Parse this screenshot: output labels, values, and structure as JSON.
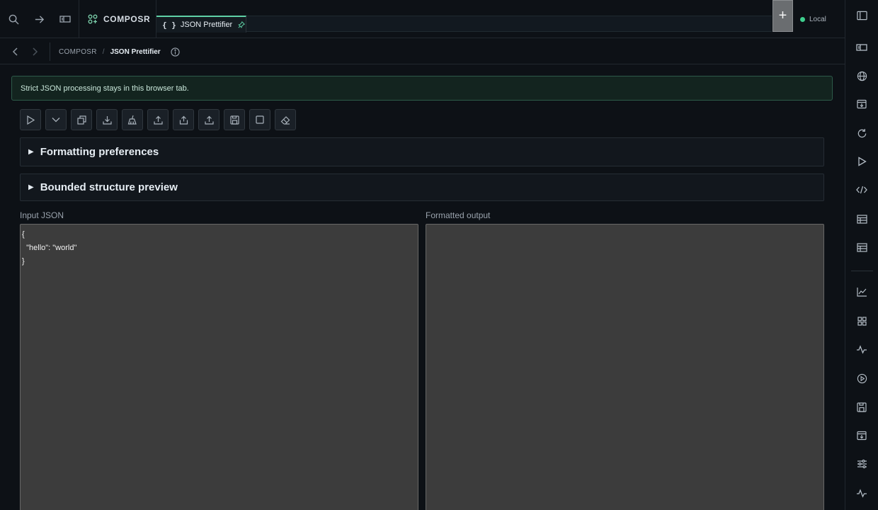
{
  "topbar": {
    "search_icon": "search-icon",
    "forward_icon": "arrow-right-icon",
    "panel_icon": "panel-icon",
    "brand": "COMPOSR",
    "brand_icon": "app-grid-icon",
    "tab": {
      "glyph": "{ }",
      "label": "JSON Prettifier",
      "pin_icon": "pin-icon"
    },
    "new_tab": "+",
    "status": {
      "label": "Local",
      "color": "#3ecf8e"
    }
  },
  "breadcrumb": {
    "root": "COMPOSR",
    "separator": "/",
    "current": "JSON Prettifier",
    "info_icon": "info-icon"
  },
  "notice": "Strict JSON processing stays in this browser tab.",
  "toolbar": [
    "run-icon",
    "chevron-down-icon",
    "copy-icon",
    "download-icon",
    "clean-icon",
    "upload-icon",
    "share-icon",
    "export-icon",
    "save-icon",
    "stop-icon",
    "eraser-icon"
  ],
  "sections": [
    {
      "label": "Formatting preferences"
    },
    {
      "label": "Bounded structure preview"
    }
  ],
  "input": {
    "label": "Input JSON",
    "value": "{\n  \"hello\": \"world\"\n}"
  },
  "output": {
    "label": "Formatted output",
    "value": ""
  },
  "rail": [
    "sidebar-toggle-icon",
    "panel-icon",
    "globe-icon",
    "archive-download-icon",
    "refresh-icon",
    "play-icon",
    "code-icon",
    "table-icon",
    "table-alt-icon",
    "chart-icon",
    "grid-icon",
    "activity-icon",
    "play-circle-icon",
    "save-icon",
    "archive-icon",
    "sliders-icon",
    "pulse-icon"
  ],
  "colors": {
    "background": "#0d1116",
    "accent": "#5fd1a6",
    "notice_bg": "#13241f",
    "editor_bg": "#3c3c3c"
  }
}
